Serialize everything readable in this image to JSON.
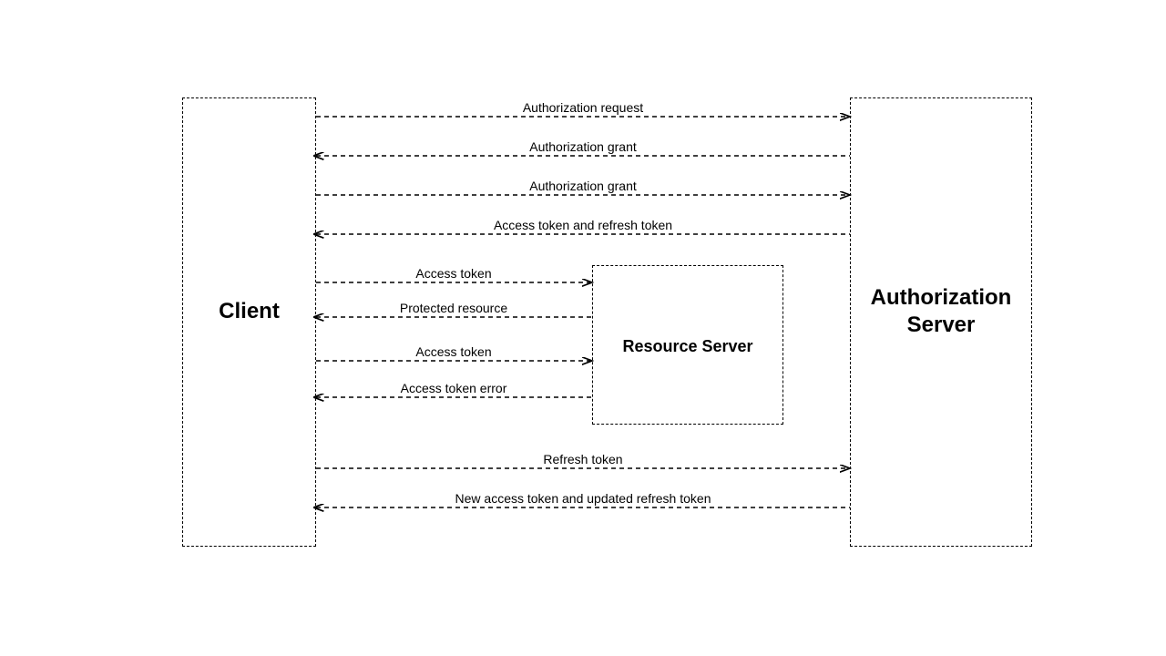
{
  "entities": {
    "client": {
      "label": "Client"
    },
    "authserver": {
      "label_line1": "Authorization",
      "label_line2": "Server"
    },
    "resource": {
      "label": "Resource Server"
    }
  },
  "messages": {
    "m1": "Authorization request",
    "m2": "Authorization grant",
    "m3": "Authorization grant",
    "m4": "Access token and refresh token",
    "m5": "Access token",
    "m6": "Protected resource",
    "m7": "Access token",
    "m8": "Access token error",
    "m9": "Refresh token",
    "m10": "New access token and updated refresh token"
  }
}
